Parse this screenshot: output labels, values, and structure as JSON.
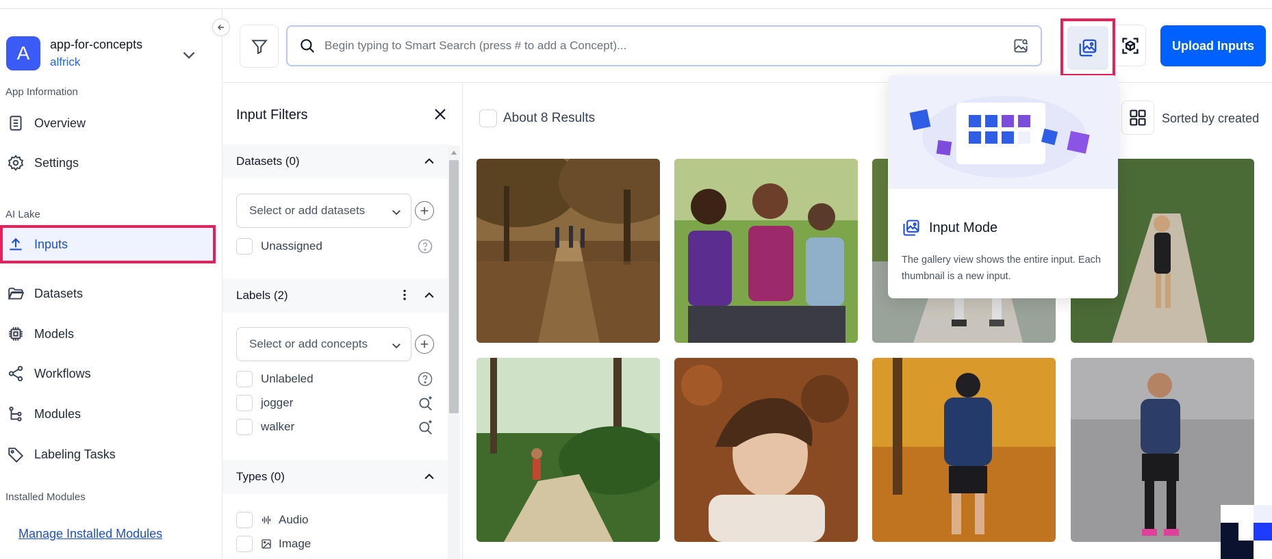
{
  "app": {
    "avatar_letter": "A",
    "name": "app-for-concepts",
    "user": "alfrick"
  },
  "sidebar": {
    "section_app_info": "App Information",
    "section_ai_lake": "AI Lake",
    "section_installed": "Installed Modules",
    "items": [
      {
        "label": "Overview",
        "icon": "document-icon"
      },
      {
        "label": "Settings",
        "icon": "gear-icon"
      },
      {
        "label": "Inputs",
        "icon": "upload-icon",
        "active": true
      },
      {
        "label": "Datasets",
        "icon": "folder-icon"
      },
      {
        "label": "Models",
        "icon": "chip-icon"
      },
      {
        "label": "Workflows",
        "icon": "share-nodes-icon"
      },
      {
        "label": "Modules",
        "icon": "tree-icon"
      },
      {
        "label": "Labeling Tasks",
        "icon": "tag-icon"
      }
    ],
    "manage_link": "Manage Installed Modules"
  },
  "search": {
    "placeholder": "Begin typing to Smart Search (press # to add a Concept)..."
  },
  "toolbar": {
    "upload_label": "Upload Inputs"
  },
  "filters": {
    "title": "Input Filters",
    "datasets": {
      "title": "Datasets (0)",
      "select_placeholder": "Select or add datasets",
      "unassigned": "Unassigned"
    },
    "labels": {
      "title": "Labels (2)",
      "select_placeholder": "Select or add concepts",
      "items": [
        "Unlabeled",
        "jogger",
        "walker"
      ]
    },
    "types": {
      "title": "Types (0)",
      "items": [
        "Audio",
        "Image"
      ]
    }
  },
  "gallery": {
    "results": "About 8 Results",
    "sort": "Sorted by created"
  },
  "popover": {
    "title": "Input Mode",
    "body": "The gallery view shows the entire input. Each thumbnail is a new input."
  },
  "colors": {
    "accent": "#0061ff",
    "highlight": "#ec1e5a",
    "active_bg": "#eef3ff"
  }
}
